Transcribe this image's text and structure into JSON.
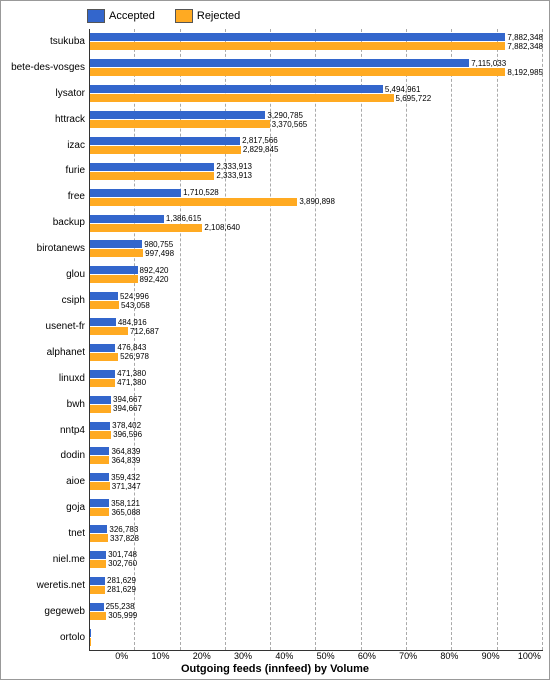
{
  "legend": {
    "accepted_label": "Accepted",
    "rejected_label": "Rejected"
  },
  "x_axis": {
    "title": "Outgoing feeds (innfeed) by Volume",
    "ticks": [
      "0%",
      "10%",
      "20%",
      "30%",
      "40%",
      "50%",
      "60%",
      "70%",
      "80%",
      "90%",
      "100%"
    ]
  },
  "max_value": 8500000,
  "bars": [
    {
      "label": "tsukuba",
      "accepted": 7882348,
      "rejected": 7882348
    },
    {
      "label": "bete-des-vosges",
      "accepted": 7115033,
      "rejected": 8192985
    },
    {
      "label": "lysator",
      "accepted": 5494961,
      "rejected": 5695722
    },
    {
      "label": "httrack",
      "accepted": 3290785,
      "rejected": 3370565
    },
    {
      "label": "izac",
      "accepted": 2817566,
      "rejected": 2829845
    },
    {
      "label": "furie",
      "accepted": 2333913,
      "rejected": 2333913
    },
    {
      "label": "free",
      "accepted": 1710528,
      "rejected": 3890898
    },
    {
      "label": "backup",
      "accepted": 1386615,
      "rejected": 2108640
    },
    {
      "label": "birotanews",
      "accepted": 980755,
      "rejected": 997498
    },
    {
      "label": "glou",
      "accepted": 892420,
      "rejected": 892420
    },
    {
      "label": "csiph",
      "accepted": 524996,
      "rejected": 543058
    },
    {
      "label": "usenet-fr",
      "accepted": 484916,
      "rejected": 712687
    },
    {
      "label": "alphanet",
      "accepted": 476843,
      "rejected": 526978
    },
    {
      "label": "linuxd",
      "accepted": 471380,
      "rejected": 471380
    },
    {
      "label": "bwh",
      "accepted": 394667,
      "rejected": 394667
    },
    {
      "label": "nntp4",
      "accepted": 378402,
      "rejected": 396596
    },
    {
      "label": "dodin",
      "accepted": 364839,
      "rejected": 364839
    },
    {
      "label": "aioe",
      "accepted": 359432,
      "rejected": 371347
    },
    {
      "label": "goja",
      "accepted": 358121,
      "rejected": 365088
    },
    {
      "label": "tnet",
      "accepted": 326783,
      "rejected": 337828
    },
    {
      "label": "niel.me",
      "accepted": 301748,
      "rejected": 302760
    },
    {
      "label": "weretis.net",
      "accepted": 281629,
      "rejected": 281629
    },
    {
      "label": "gegeweb",
      "accepted": 255238,
      "rejected": 305999
    },
    {
      "label": "ortolo",
      "accepted": 0,
      "rejected": 0
    }
  ]
}
